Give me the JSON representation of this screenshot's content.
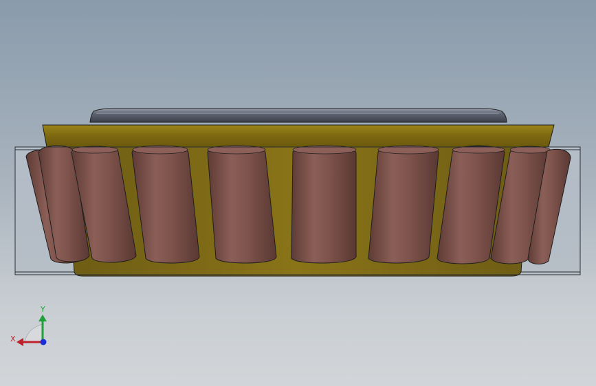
{
  "scene": {
    "model_name": "tapered-roller-bearing",
    "roller_count_visible": 11,
    "colors": {
      "background_top": "#8a9bab",
      "background_bottom": "#d2d5d8",
      "cone": "#8a7414",
      "cone_dark": "#5f4f08",
      "roller": "#7b5149",
      "roller_highlight": "#936860",
      "roller_shadow": "#5a3833",
      "inner_ring": "#5d6270",
      "cup": "#a8b2bc",
      "outline": "#1e1e1e"
    }
  },
  "triad": {
    "x_label": "X",
    "y_label": "Y",
    "x_color": "#c0202a",
    "y_color": "#1fa03a",
    "z_color": "#1c2fd6"
  }
}
